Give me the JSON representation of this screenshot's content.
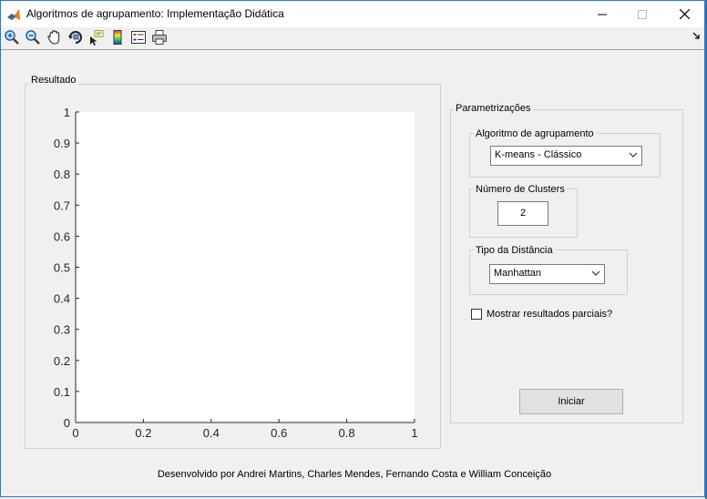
{
  "window": {
    "title": "Algoritmos de agrupamento: Implementação Didática"
  },
  "toolbar": {
    "icons": [
      "zoom-in-icon",
      "zoom-out-icon",
      "pan-hand-icon",
      "rotate-3d-icon",
      "data-cursor-icon",
      "colorbar-icon",
      "legend-icon",
      "print-icon"
    ]
  },
  "result_panel": {
    "title": "Resultado",
    "chart_data": {
      "type": "scatter",
      "x": [],
      "y": [],
      "xlim": [
        0,
        1
      ],
      "ylim": [
        0,
        1
      ],
      "xticks": [
        "0",
        "0.2",
        "0.4",
        "0.6",
        "0.8",
        "1"
      ],
      "yticks": [
        "0",
        "0.1",
        "0.2",
        "0.3",
        "0.4",
        "0.5",
        "0.6",
        "0.7",
        "0.8",
        "0.9",
        "1"
      ],
      "grid": false
    }
  },
  "params_panel": {
    "title": "Parametrizações",
    "algorithm": {
      "title": "Algoritmo de agrupamento",
      "selected": "K-means - Clássico"
    },
    "clusters": {
      "title": "Número de Clusters",
      "value": "2"
    },
    "distance": {
      "title": "Tipo da Distância",
      "selected": "Manhattan"
    },
    "partial_results": {
      "label": "Mostrar resultados parciais?",
      "checked": false
    },
    "start_button": "Iniciar"
  },
  "footer": "Desenvolvido por Andrei Martins, Charles Mendes, Fernando Costa e William Conceição"
}
